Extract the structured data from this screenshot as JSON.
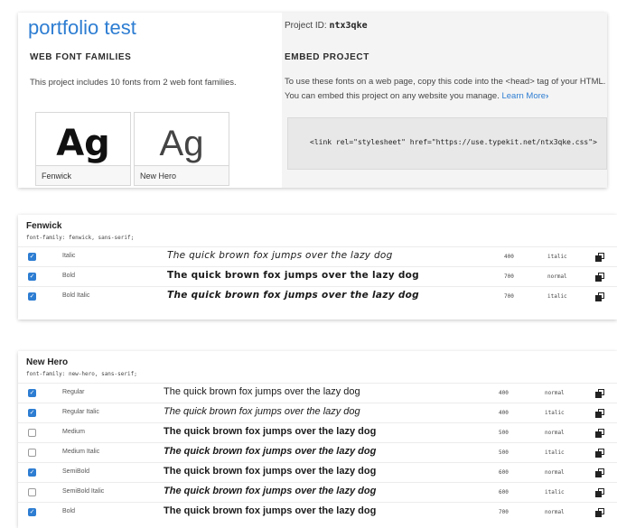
{
  "project": {
    "title": "portfolio test",
    "id_label": "Project ID:",
    "id_value": "ntx3qke",
    "web_font_families_heading": "WEB FONT FAMILIES",
    "web_font_families_desc": "This project includes 10 fonts from 2 web font families.",
    "tiles": [
      {
        "sample": "Ag",
        "name": "Fenwick"
      },
      {
        "sample": "Ag",
        "name": "New Hero"
      }
    ],
    "embed_heading": "EMBED PROJECT",
    "embed_desc_1": "To use these fonts on a web page, copy this code into the <head> tag of your HTML.",
    "embed_desc_2": "You can embed this project on any website you manage.",
    "learn_more": "Learn More",
    "chevron": "›",
    "embed_code": "<link rel=\"stylesheet\" href=\"https://use.typekit.net/ntx3qke.css\">"
  },
  "families": [
    {
      "name": "Fenwick",
      "css": "font-family: fenwick, sans-serif;",
      "rows": [
        {
          "checked": true,
          "style": "Italic",
          "sample": "The quick brown fox jumps over the lazy dog",
          "weight": "400",
          "font_style": "italic"
        },
        {
          "checked": true,
          "style": "Bold",
          "sample": "The quick brown fox jumps over the lazy dog",
          "weight": "700",
          "font_style": "normal"
        },
        {
          "checked": true,
          "style": "Bold Italic",
          "sample": "The quick brown fox jumps over the lazy dog",
          "weight": "700",
          "font_style": "italic"
        }
      ]
    },
    {
      "name": "New Hero",
      "css": "font-family: new-hero, sans-serif;",
      "rows": [
        {
          "checked": true,
          "style": "Regular",
          "sample": "The quick brown fox jumps over the lazy dog",
          "weight": "400",
          "font_style": "normal"
        },
        {
          "checked": true,
          "style": "Regular Italic",
          "sample": "The quick brown fox jumps over the lazy dog",
          "weight": "400",
          "font_style": "italic"
        },
        {
          "checked": false,
          "style": "Medium",
          "sample": "The quick brown fox jumps over the lazy dog",
          "weight": "500",
          "font_style": "normal"
        },
        {
          "checked": false,
          "style": "Medium Italic",
          "sample": "The quick brown fox jumps over the lazy dog",
          "weight": "500",
          "font_style": "italic"
        },
        {
          "checked": true,
          "style": "SemiBold",
          "sample": "The quick brown fox jumps over the lazy dog",
          "weight": "600",
          "font_style": "normal"
        },
        {
          "checked": false,
          "style": "SemiBold Italic",
          "sample": "The quick brown fox jumps over the lazy dog",
          "weight": "600",
          "font_style": "italic"
        },
        {
          "checked": true,
          "style": "Bold",
          "sample": "The quick brown fox jumps over the lazy dog",
          "weight": "700",
          "font_style": "normal"
        }
      ]
    }
  ],
  "icons": {
    "checkbox_checked": "check-icon",
    "copy": "copy-icon"
  },
  "colors": {
    "accent": "#2d7dd2"
  }
}
